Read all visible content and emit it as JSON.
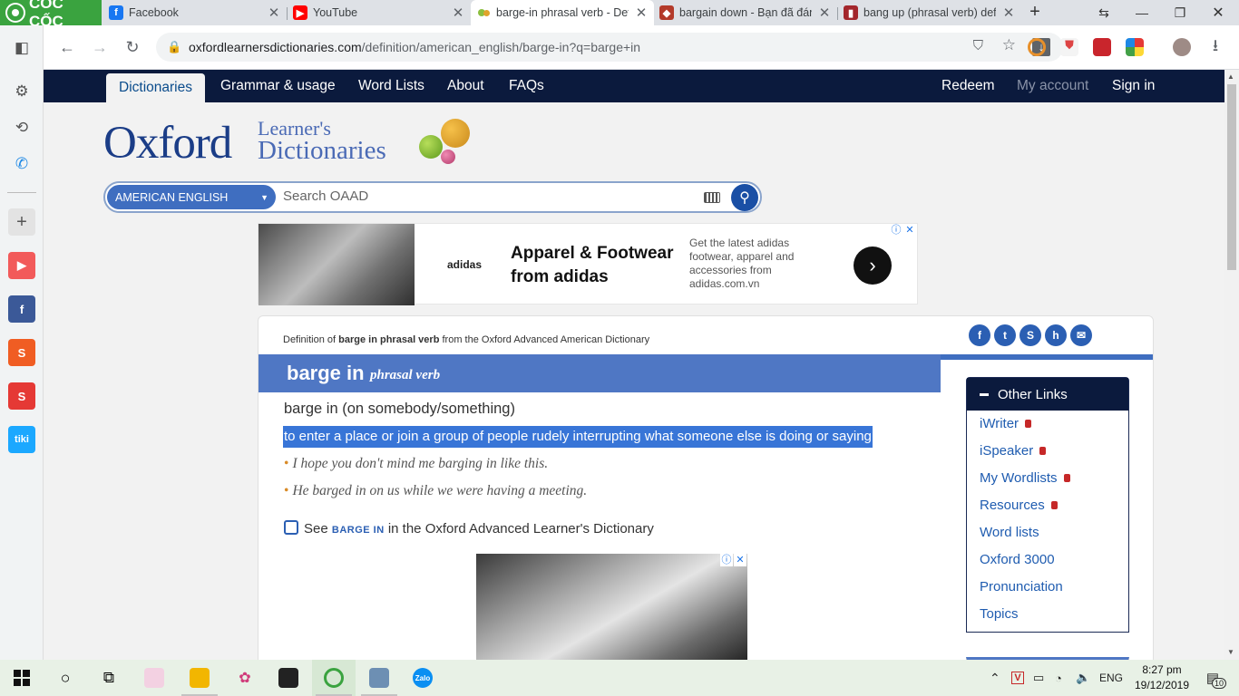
{
  "browser": {
    "brand": "CỐC CỐC",
    "tabs": [
      {
        "title": "Facebook",
        "icon": "facebook-icon",
        "color": "#1877f2",
        "active": false
      },
      {
        "title": "YouTube",
        "icon": "youtube-icon",
        "color": "#ff0000",
        "active": false
      },
      {
        "title": "barge-in phrasal verb - Defi",
        "icon": "oxford-balls-icon",
        "color": "#3f6ec0",
        "active": true
      },
      {
        "title": "bargain down - Bạn đã đánh",
        "icon": "cambridge-icon",
        "color": "#b33a2a",
        "active": false
      },
      {
        "title": "bang up (phrasal verb) defi",
        "icon": "book-icon",
        "color": "#a3262c",
        "active": false
      }
    ],
    "url_domain": "oxfordlearnersdictionaries.com",
    "url_path": "/definition/american_english/barge-in?q=barge+in"
  },
  "site_nav": {
    "left": [
      "Dictionaries",
      "Grammar & usage",
      "Word Lists",
      "About",
      "FAQs"
    ],
    "right": [
      "Redeem",
      "My account",
      "Sign in"
    ]
  },
  "logo": {
    "oxford": "Oxford",
    "line1": "Learner's",
    "line2": "Dictionaries"
  },
  "search": {
    "dictionary": "AMERICAN ENGLISH",
    "placeholder": "Search OAAD"
  },
  "ad": {
    "brand": "adidas",
    "headline": "Apparel & Footwear from adidas",
    "description": "Get the latest adidas footwear, apparel and accessories from adidas.com.vn"
  },
  "entry": {
    "def_of_prefix": "Definition of",
    "def_of_word": "barge in phrasal verb",
    "def_of_suffix": "from the Oxford Advanced American Dictionary",
    "headword": "barge in",
    "pos": "phrasal verb",
    "sense_pattern": "barge in (on somebody/something)",
    "definition": "to enter a place or join a group of people rudely interrupting what someone else is doing or saying",
    "examples": [
      "I hope you don't mind me barging in like this.",
      "He barged in on us while we were having a meeting."
    ],
    "see_prefix": "See",
    "see_word": "barge in",
    "see_suffix": "in the Oxford Advanced Learner's Dictionary"
  },
  "other_links": {
    "title": "Other Links",
    "items": [
      {
        "label": "iWriter",
        "locked": true
      },
      {
        "label": "iSpeaker",
        "locked": true
      },
      {
        "label": "My Wordlists",
        "locked": true
      },
      {
        "label": "Resources",
        "locked": true
      },
      {
        "label": "Word lists",
        "locked": false
      },
      {
        "label": "Oxford 3000",
        "locked": false
      },
      {
        "label": "Pronunciation",
        "locked": false
      },
      {
        "label": "Topics",
        "locked": false
      }
    ]
  },
  "taskbar": {
    "lang": "ENG",
    "time": "8:27 pm",
    "date": "19/12/2019",
    "notifications": "10"
  },
  "colors": {
    "nav_bg": "#0b1a3d",
    "header_blue": "#4f77c4",
    "highlight": "#3875d7",
    "brand_green": "#3aa33f"
  }
}
